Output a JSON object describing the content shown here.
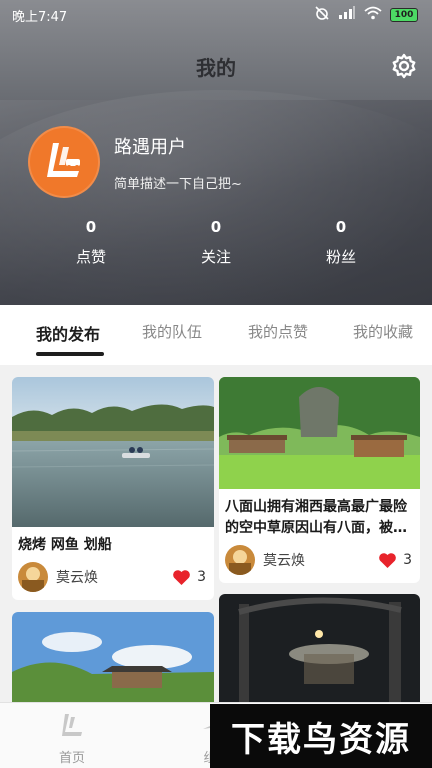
{
  "status_bar": {
    "time": "晚上7:47",
    "battery": "100"
  },
  "header": {
    "title": "我的"
  },
  "profile": {
    "username": "路遇用户",
    "bio": "简单描述一下自己把~"
  },
  "stats": [
    {
      "value": "0",
      "label": "点赞"
    },
    {
      "value": "0",
      "label": "关注"
    },
    {
      "value": "0",
      "label": "粉丝"
    }
  ],
  "tabs": [
    {
      "label": "我的发布",
      "active": true
    },
    {
      "label": "我的队伍",
      "active": false
    },
    {
      "label": "我的点赞",
      "active": false
    },
    {
      "label": "我的收藏",
      "active": false
    }
  ],
  "posts": [
    {
      "title": "烧烤  网鱼 划船",
      "author": "莫云焕",
      "likes": "3"
    },
    {
      "title": "八面山拥有湘西最高最广最险的空中草原因山有八面，被…",
      "author": "莫云焕",
      "likes": "3"
    }
  ],
  "bottom_nav": [
    {
      "label": "首页"
    },
    {
      "label": "组"
    }
  ],
  "watermark": {
    "text": "下载鸟资源"
  },
  "colors": {
    "accent": "#f0782a",
    "heart": "#e8232b",
    "active_tab": "#1e1e1e"
  }
}
